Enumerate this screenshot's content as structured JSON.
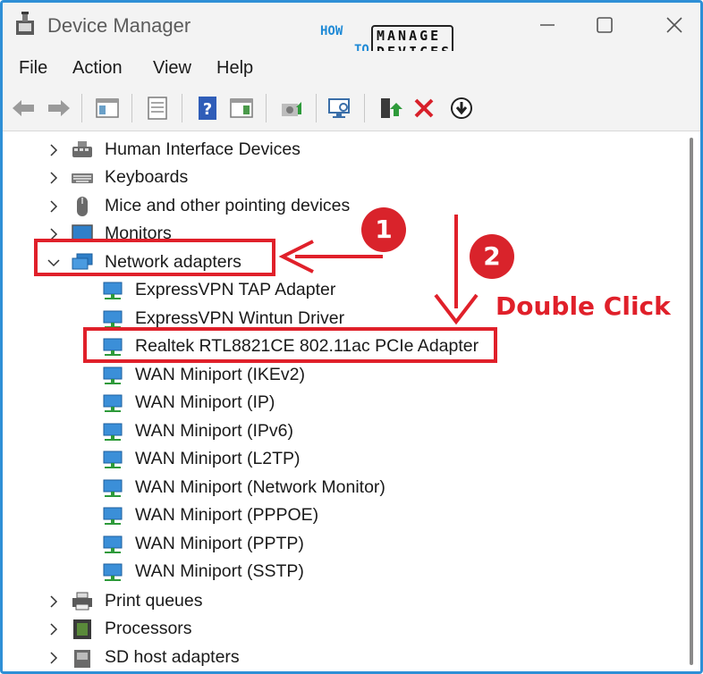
{
  "window": {
    "title": "Device Manager",
    "logo": {
      "how": "HOW",
      "to": "TO",
      "manage": "MANAGE",
      "devices": "DEVICES"
    }
  },
  "menu": [
    "File",
    "Action",
    "View",
    "Help"
  ],
  "toolbar": {
    "buttons": [
      "back-icon",
      "forward-icon",
      "show-hide-console-tree-icon",
      "properties-icon",
      "help-icon",
      "action-pane-icon",
      "update-driver-icon",
      "scan-hardware-icon",
      "enable-device-icon",
      "uninstall-device-icon",
      "disable-device-icon"
    ]
  },
  "tree": {
    "top_categories": [
      {
        "label": "Human Interface Devices",
        "icon": "hid-icon",
        "expanded": false
      },
      {
        "label": "Keyboards",
        "icon": "keyboard-icon",
        "expanded": false
      },
      {
        "label": "Mice and other pointing devices",
        "icon": "mouse-icon",
        "expanded": false
      },
      {
        "label": "Monitors",
        "icon": "monitor-icon",
        "expanded": false
      },
      {
        "label": "Network adapters",
        "icon": "network-adapter-icon",
        "expanded": true
      }
    ],
    "network_adapters": [
      "ExpressVPN TAP Adapter",
      "ExpressVPN Wintun Driver",
      "Realtek RTL8821CE 802.11ac PCIe Adapter",
      "WAN Miniport (IKEv2)",
      "WAN Miniport (IP)",
      "WAN Miniport (IPv6)",
      "WAN Miniport (L2TP)",
      "WAN Miniport (Network Monitor)",
      "WAN Miniport (PPPOE)",
      "WAN Miniport (PPTP)",
      "WAN Miniport (SSTP)"
    ],
    "bottom_categories": [
      {
        "label": "Print queues",
        "icon": "printer-icon",
        "expanded": false
      },
      {
        "label": "Processors",
        "icon": "processor-icon",
        "expanded": false
      },
      {
        "label": "SD host adapters",
        "icon": "sd-host-icon",
        "expanded": false
      }
    ]
  },
  "annotations": {
    "badge1": "1",
    "badge2": "2",
    "instruction": "Double Click",
    "color": "#e0202a"
  }
}
